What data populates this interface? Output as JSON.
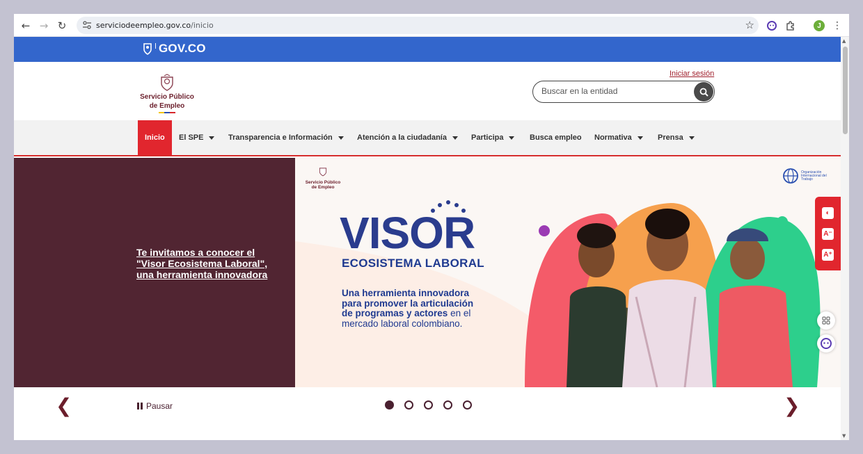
{
  "browser": {
    "url_domain": "serviciodeempleo.gov.co",
    "url_path": "/inicio",
    "profile_initial": "J"
  },
  "govbar": {
    "logo_text": "GOV.CO"
  },
  "header": {
    "logo_line1": "Servicio Público",
    "logo_line2": "de Empleo",
    "login_label": "Iniciar sesión",
    "search_placeholder": "Buscar en la entidad"
  },
  "nav": {
    "items": [
      {
        "label": "Inicio",
        "dropdown": false,
        "active": true
      },
      {
        "label": "El SPE",
        "dropdown": true
      },
      {
        "label": "Transparencia e Información",
        "dropdown": true
      },
      {
        "label": "Atención a la ciudadanía",
        "dropdown": true
      },
      {
        "label": "Participa",
        "dropdown": true
      },
      {
        "label": "Busca empleo",
        "dropdown": false
      },
      {
        "label": "Normativa",
        "dropdown": true
      },
      {
        "label": "Prensa",
        "dropdown": true
      }
    ]
  },
  "hero": {
    "link_text": "Te invitamos a conocer el \"Visor Ecosistema Laboral\", una herramienta innovadora",
    "banner": {
      "small_logo_line1": "Servicio Público",
      "small_logo_line2": "de Empleo",
      "oit_text": "Organización Internacional del Trabajo",
      "title": "VISOR",
      "subtitle": "ECOSISTEMA LABORAL",
      "desc_bold1": "Una herramienta innovadora",
      "desc_bold2": "para promover la articulación",
      "desc_bold3": "de programas y actores",
      "desc_rest": " en el mercado laboral colombiano."
    }
  },
  "carousel": {
    "pause_label": "Pausar",
    "slide_count": 5,
    "active_slide": 1
  },
  "colors": {
    "gov_blue": "#3366cc",
    "spe_maroon": "#512532",
    "accent_red": "#e1262e"
  }
}
